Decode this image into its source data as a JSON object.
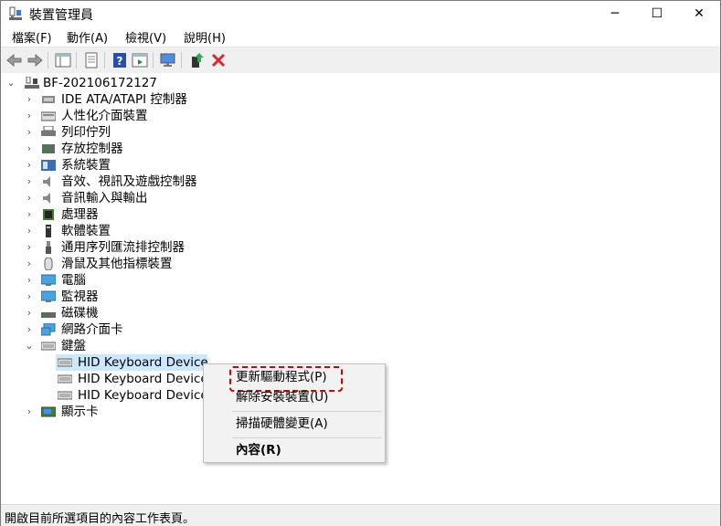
{
  "window": {
    "title": "裝置管理員",
    "minimize": "─",
    "maximize": "☐",
    "close": "✕"
  },
  "menu": [
    "檔案(F)",
    "動作(A)",
    "檢視(V)",
    "說明(H)"
  ],
  "toolbar": {
    "icons": [
      "back-arrow-icon",
      "forward-arrow-icon",
      "show-hide-console-tree-icon",
      "properties-icon",
      "help-icon",
      "action-pane-icon",
      "scan-hardware-icon",
      "update-driver-icon",
      "uninstall-device-icon"
    ]
  },
  "tree": {
    "root": "BF-202106172127",
    "categories": [
      {
        "label": "IDE ATA/ATAPI 控制器",
        "icon": "ide-controller-icon"
      },
      {
        "label": "人性化介面裝置",
        "icon": "hid-device-icon"
      },
      {
        "label": "列印佇列",
        "icon": "printer-icon"
      },
      {
        "label": "存放控制器",
        "icon": "storage-controller-icon"
      },
      {
        "label": "系統裝置",
        "icon": "system-device-icon"
      },
      {
        "label": "音效、視訊及遊戲控制器",
        "icon": "speaker-icon"
      },
      {
        "label": "音訊輸入與輸出",
        "icon": "audio-io-icon"
      },
      {
        "label": "處理器",
        "icon": "processor-icon"
      },
      {
        "label": "軟體裝置",
        "icon": "software-device-icon"
      },
      {
        "label": "通用序列匯流排控制器",
        "icon": "usb-icon"
      },
      {
        "label": "滑鼠及其他指標裝置",
        "icon": "mouse-icon"
      },
      {
        "label": "電腦",
        "icon": "computer-icon"
      },
      {
        "label": "監視器",
        "icon": "monitor-icon"
      },
      {
        "label": "磁碟機",
        "icon": "disk-drive-icon"
      },
      {
        "label": "網路介面卡",
        "icon": "network-adapter-icon"
      }
    ],
    "keyboard": {
      "label": "鍵盤",
      "children": [
        "HID Keyboard Device",
        "HID Keyboard Device",
        "HID Keyboard Device"
      ]
    },
    "display": {
      "label": "顯示卡",
      "icon": "display-adapter-icon"
    }
  },
  "context_menu": {
    "items": [
      "更新驅動程式(P)",
      "解除安裝裝置(U)",
      "掃描硬體變更(A)",
      "內容(R)"
    ]
  },
  "status": "開啟目前所選項目的內容工作表頁。",
  "colors": {
    "selection": "#cce8ff",
    "highlight_border": "#d10000"
  }
}
